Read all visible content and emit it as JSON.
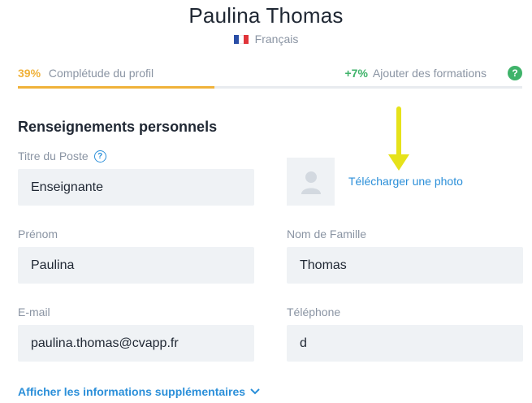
{
  "profile": {
    "name": "Paulina Thomas",
    "language": "Français",
    "language_flag_colors": [
      "#2a4ea6",
      "#ffffff",
      "#e0343a"
    ]
  },
  "progress": {
    "percent_label": "39%",
    "percent_text": "Complétude du profil",
    "completion_fraction": 0.39,
    "bonus_label": "+7%",
    "bonus_text": "Ajouter des formations",
    "help_icon": "question-circle-icon"
  },
  "section": {
    "title": "Renseignements personnels"
  },
  "fields": {
    "job_title": {
      "label": "Titre du Poste",
      "value": "Enseignante"
    },
    "first_name": {
      "label": "Prénom",
      "value": "Paulina"
    },
    "last_name": {
      "label": "Nom de Famille",
      "value": "Thomas"
    },
    "email": {
      "label": "E-mail",
      "value": "paulina.thomas@cvapp.fr"
    },
    "phone": {
      "label": "Téléphone",
      "value": "d"
    }
  },
  "photo": {
    "upload_label": "Télécharger une photo",
    "placeholder_icon": "user-silhouette-icon"
  },
  "more": {
    "label": "Afficher les informations supplémentaires",
    "icon": "chevron-down-icon"
  },
  "colors": {
    "accent_blue": "#2b8fd9",
    "progress_yellow": "#f0b23a",
    "bonus_green": "#3fb36a",
    "annotation_arrow": "#e6e21a"
  }
}
